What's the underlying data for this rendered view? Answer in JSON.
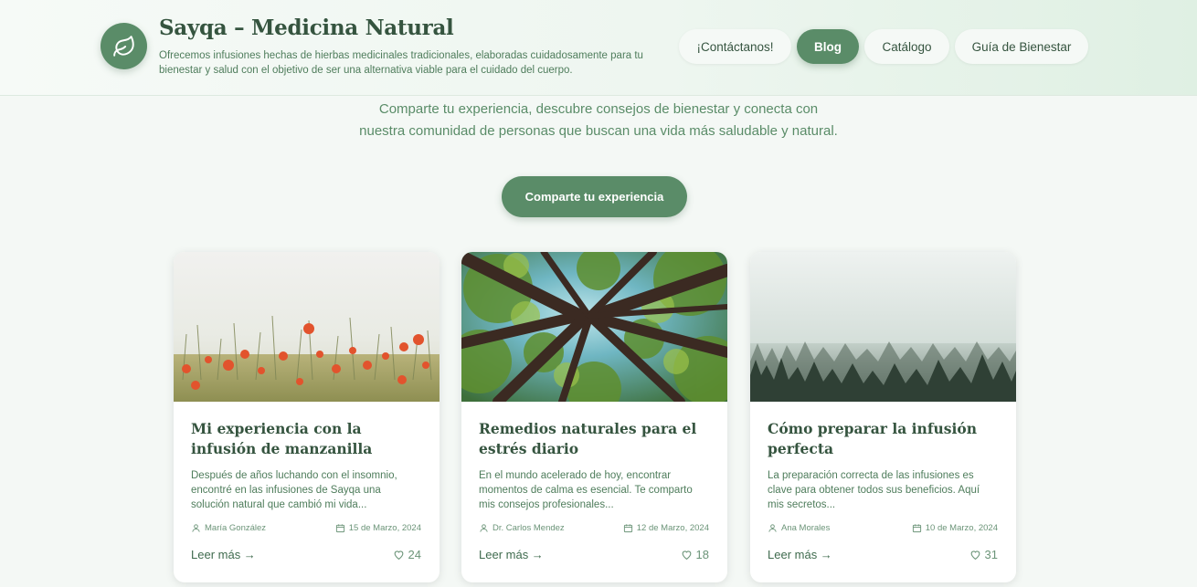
{
  "header": {
    "title": "Sayqa – Medicina Natural",
    "description": "Ofrecemos infusiones hechas de hierbas medicinales tradicionales, elaboradas cuidadosamente para tu bienestar y salud con el objetivo de ser una alternativa viable para el cuidado del cuerpo.",
    "logo_icon": "leaf-icon"
  },
  "nav": {
    "contact": "¡Contáctanos!",
    "blog": "Blog",
    "catalog": "Catálogo",
    "guide": "Guía de Bienestar",
    "active": "Blog"
  },
  "intro": {
    "line1": "Comparte tu experiencia, descubre consejos de bienestar y conecta con",
    "line2": "nuestra comunidad de personas que buscan una vida más saludable y natural."
  },
  "cta": {
    "label": "Comparte tu experiencia"
  },
  "posts": [
    {
      "title": "Mi experiencia con la infusión de manzanilla",
      "excerpt": "Después de años luchando con el insomnio, encontré en las infusiones de Sayqa una solución natural que cambió mi vida...",
      "author": "María González",
      "date": "15 de Marzo, 2024",
      "read_more": "Leer más →",
      "likes": "24",
      "image": "poppy-field"
    },
    {
      "title": "Remedios naturales para el estrés diario",
      "excerpt": "En el mundo acelerado de hoy, encontrar momentos de calma es esencial. Te comparto mis consejos profesionales...",
      "author": "Dr. Carlos Mendez",
      "date": "12 de Marzo, 2024",
      "read_more": "Leer más →",
      "likes": "18",
      "image": "forest-canopy"
    },
    {
      "title": "Cómo preparar la infusión perfecta",
      "excerpt": "La preparación correcta de las infusiones es clave para obtener todos sus beneficios. Aquí mis secretos...",
      "author": "Ana Morales",
      "date": "10 de Marzo, 2024",
      "read_more": "Leer más →",
      "likes": "31",
      "image": "misty-forest"
    }
  ],
  "colors": {
    "primary": "#5a8c68",
    "heading": "#35543f",
    "text": "#4f7d5c",
    "background": "#f4f8f5"
  }
}
